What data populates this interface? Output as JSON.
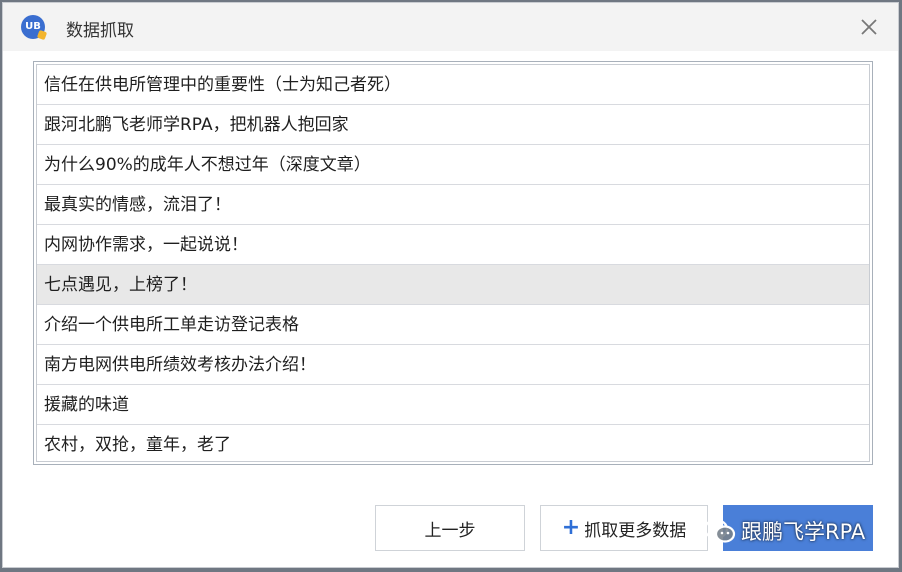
{
  "window": {
    "title": "数据抓取",
    "logo_text": "UB",
    "close_glyph": "×"
  },
  "list": {
    "selected_index": 5,
    "items": [
      "信任在供电所管理中的重要性（士为知己者死）",
      "跟河北鹏飞老师学RPA，把机器人抱回家",
      "为什么90%的成年人不想过年（深度文章）",
      "最真实的情感，流泪了！",
      "内网协作需求，一起说说！",
      "七点遇见，上榜了！",
      "介绍一个供电所工单走访登记表格",
      "南方电网供电所绩效考核办法介绍！",
      "援藏的味道",
      "农村，双抢，童年，老了"
    ]
  },
  "buttons": {
    "prev_label": "上一步",
    "more_label": "抓取更多数据",
    "more_icon": "+",
    "primary_label": ""
  },
  "watermark": {
    "text": "跟鹏飞学RPA",
    "icon": "wechat-icon"
  },
  "colors": {
    "accent": "#4a7fd8",
    "selected_row": "#e8e8e8",
    "titlebar": "#f3f3f3"
  }
}
